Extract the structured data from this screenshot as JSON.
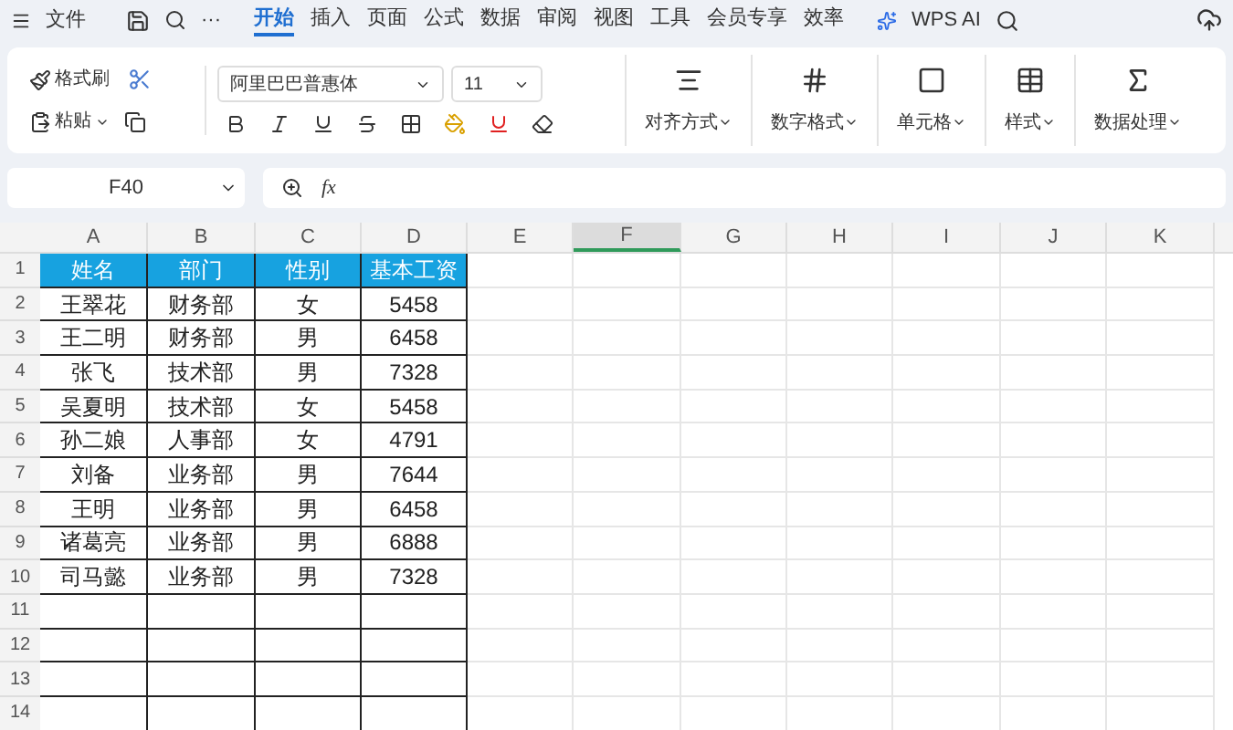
{
  "menu": {
    "file": "文件",
    "more": "···",
    "tabs": [
      {
        "label": "开始",
        "selected": true
      },
      {
        "label": "插入",
        "selected": false
      },
      {
        "label": "页面",
        "selected": false
      },
      {
        "label": "公式",
        "selected": false
      },
      {
        "label": "数据",
        "selected": false
      },
      {
        "label": "审阅",
        "selected": false
      },
      {
        "label": "视图",
        "selected": false
      },
      {
        "label": "工具",
        "selected": false
      },
      {
        "label": "会员专享",
        "selected": false
      },
      {
        "label": "效率",
        "selected": false
      }
    ],
    "ai": "WPS AI"
  },
  "ribbon": {
    "format_painter": "格式刷",
    "paste": "粘贴",
    "font_name": "阿里巴巴普惠体",
    "font_size": "11",
    "groups": [
      {
        "label": "对齐方式",
        "kind": "align"
      },
      {
        "label": "数字格式",
        "kind": "number"
      },
      {
        "label": "单元格",
        "kind": "cell"
      },
      {
        "label": "样式",
        "kind": "style"
      },
      {
        "label": "数据处理",
        "kind": "sum"
      }
    ]
  },
  "formula_bar": {
    "cell_ref": "F40",
    "fx": "fx"
  },
  "sheet": {
    "columns": [
      {
        "label": "A",
        "selected": false
      },
      {
        "label": "B",
        "selected": false
      },
      {
        "label": "C",
        "selected": false
      },
      {
        "label": "D",
        "selected": false
      },
      {
        "label": "E",
        "selected": false
      },
      {
        "label": "F",
        "selected": true
      },
      {
        "label": "G",
        "selected": false
      },
      {
        "label": "H",
        "selected": false
      },
      {
        "label": "I",
        "selected": false
      },
      {
        "label": "J",
        "selected": false
      },
      {
        "label": "K",
        "selected": false
      }
    ],
    "header": [
      "姓名",
      "部门",
      "性别",
      "基本工资"
    ],
    "rows": [
      [
        "王翠花",
        "财务部",
        "女",
        "5458"
      ],
      [
        "王二明",
        "财务部",
        "男",
        "6458"
      ],
      [
        "张飞",
        "技术部",
        "男",
        "7328"
      ],
      [
        "吴夏明",
        "技术部",
        "女",
        "5458"
      ],
      [
        "孙二娘",
        "人事部",
        "女",
        "4791"
      ],
      [
        "刘备",
        "业务部",
        "男",
        "7644"
      ],
      [
        "王明",
        "业务部",
        "男",
        "6458"
      ],
      [
        "诸葛亮",
        "业务部",
        "男",
        "6888"
      ],
      [
        "司马懿",
        "业务部",
        "男",
        "7328"
      ]
    ],
    "row_numbers": [
      "1",
      "2",
      "3",
      "4",
      "5",
      "6",
      "7",
      "8",
      "9",
      "10",
      "11",
      "12",
      "13",
      "14"
    ]
  }
}
